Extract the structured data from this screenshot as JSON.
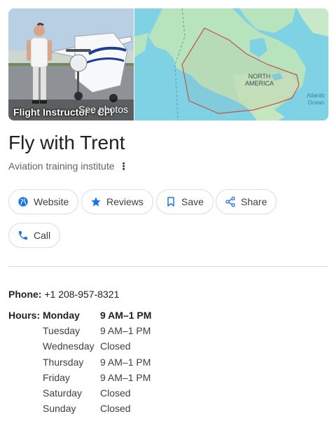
{
  "media": {
    "photo_caption": "Flight Instructor - CFI",
    "see_photos_label": "See photos",
    "map_labels": {
      "continent_line1": "NORTH",
      "continent_line2": "AMERICA",
      "ocean_line1": "Atlantic",
      "ocean_line2": "Ocean"
    }
  },
  "business": {
    "name": "Fly with Trent",
    "category": "Aviation training institute"
  },
  "actions": {
    "website": "Website",
    "reviews": "Reviews",
    "save": "Save",
    "share": "Share",
    "call": "Call"
  },
  "contact": {
    "phone_label": "Phone:",
    "phone_value": "+1 208-957-8321"
  },
  "hours": {
    "label": "Hours:",
    "days": [
      {
        "day": "Monday",
        "time": "9 AM–1 PM"
      },
      {
        "day": "Tuesday",
        "time": "9 AM–1 PM"
      },
      {
        "day": "Wednesday",
        "time": "Closed"
      },
      {
        "day": "Thursday",
        "time": "9 AM–1 PM"
      },
      {
        "day": "Friday",
        "time": "9 AM–1 PM"
      },
      {
        "day": "Saturday",
        "time": "Closed"
      },
      {
        "day": "Sunday",
        "time": "Closed"
      }
    ]
  },
  "colors": {
    "accent_blue": "#1a73e8",
    "map_water": "#7fd2e4",
    "map_land": "#b7e3bd",
    "service_area_outline": "#c5504a"
  },
  "icons": {
    "website": "globe-icon",
    "reviews": "star-icon",
    "save": "bookmark-icon",
    "share": "share-icon",
    "call": "phone-icon",
    "more": "more-vertical-icon"
  }
}
